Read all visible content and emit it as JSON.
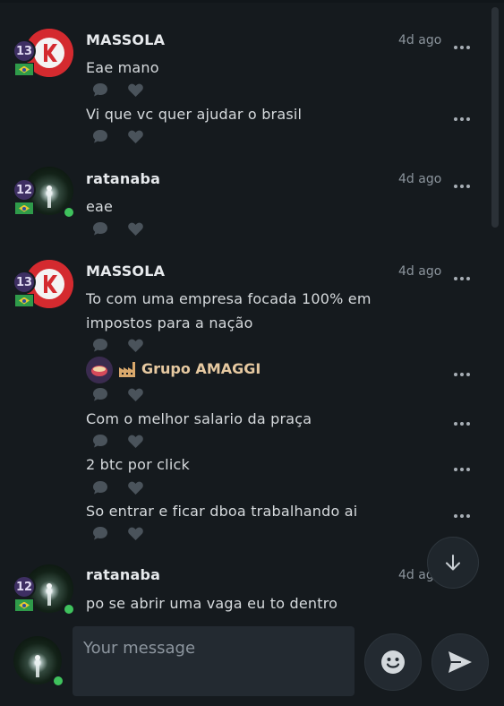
{
  "messages": [
    {
      "username": "MASSOLA",
      "level": "13",
      "time": "4d ago",
      "lines": [
        "Eae mano",
        "Vi que vc quer ajudar o brasil"
      ]
    },
    {
      "username": "ratanaba",
      "level": "12",
      "time": "4d ago",
      "lines": [
        "eae"
      ]
    },
    {
      "username": "MASSOLA",
      "level": "13",
      "time": "4d ago",
      "lines": [
        "To com uma empresa focada 100% em impostos para a nação",
        "Com o melhor salario da praça",
        "2 btc por click",
        "So entrar e ficar dboa trabalhando ai"
      ],
      "group_tag": "Grupo AMAGGI"
    },
    {
      "username": "ratanaba",
      "level": "12",
      "time": "4d ago",
      "lines": [
        "po se abrir uma vaga eu to dentro"
      ]
    }
  ],
  "composer": {
    "placeholder": "Your message",
    "value": ""
  },
  "icons": {
    "reply": "comment-icon",
    "like": "heart-icon",
    "more": "more-dots-icon",
    "scroll": "arrow-down-icon",
    "emoji": "smiley-icon",
    "send": "send-icon",
    "flag": "brazil-flag-icon"
  },
  "colors": {
    "background": "#151a1e",
    "level_badge": "#3e2f63",
    "online": "#3fc25d",
    "group_name": "#e6c9a1"
  }
}
